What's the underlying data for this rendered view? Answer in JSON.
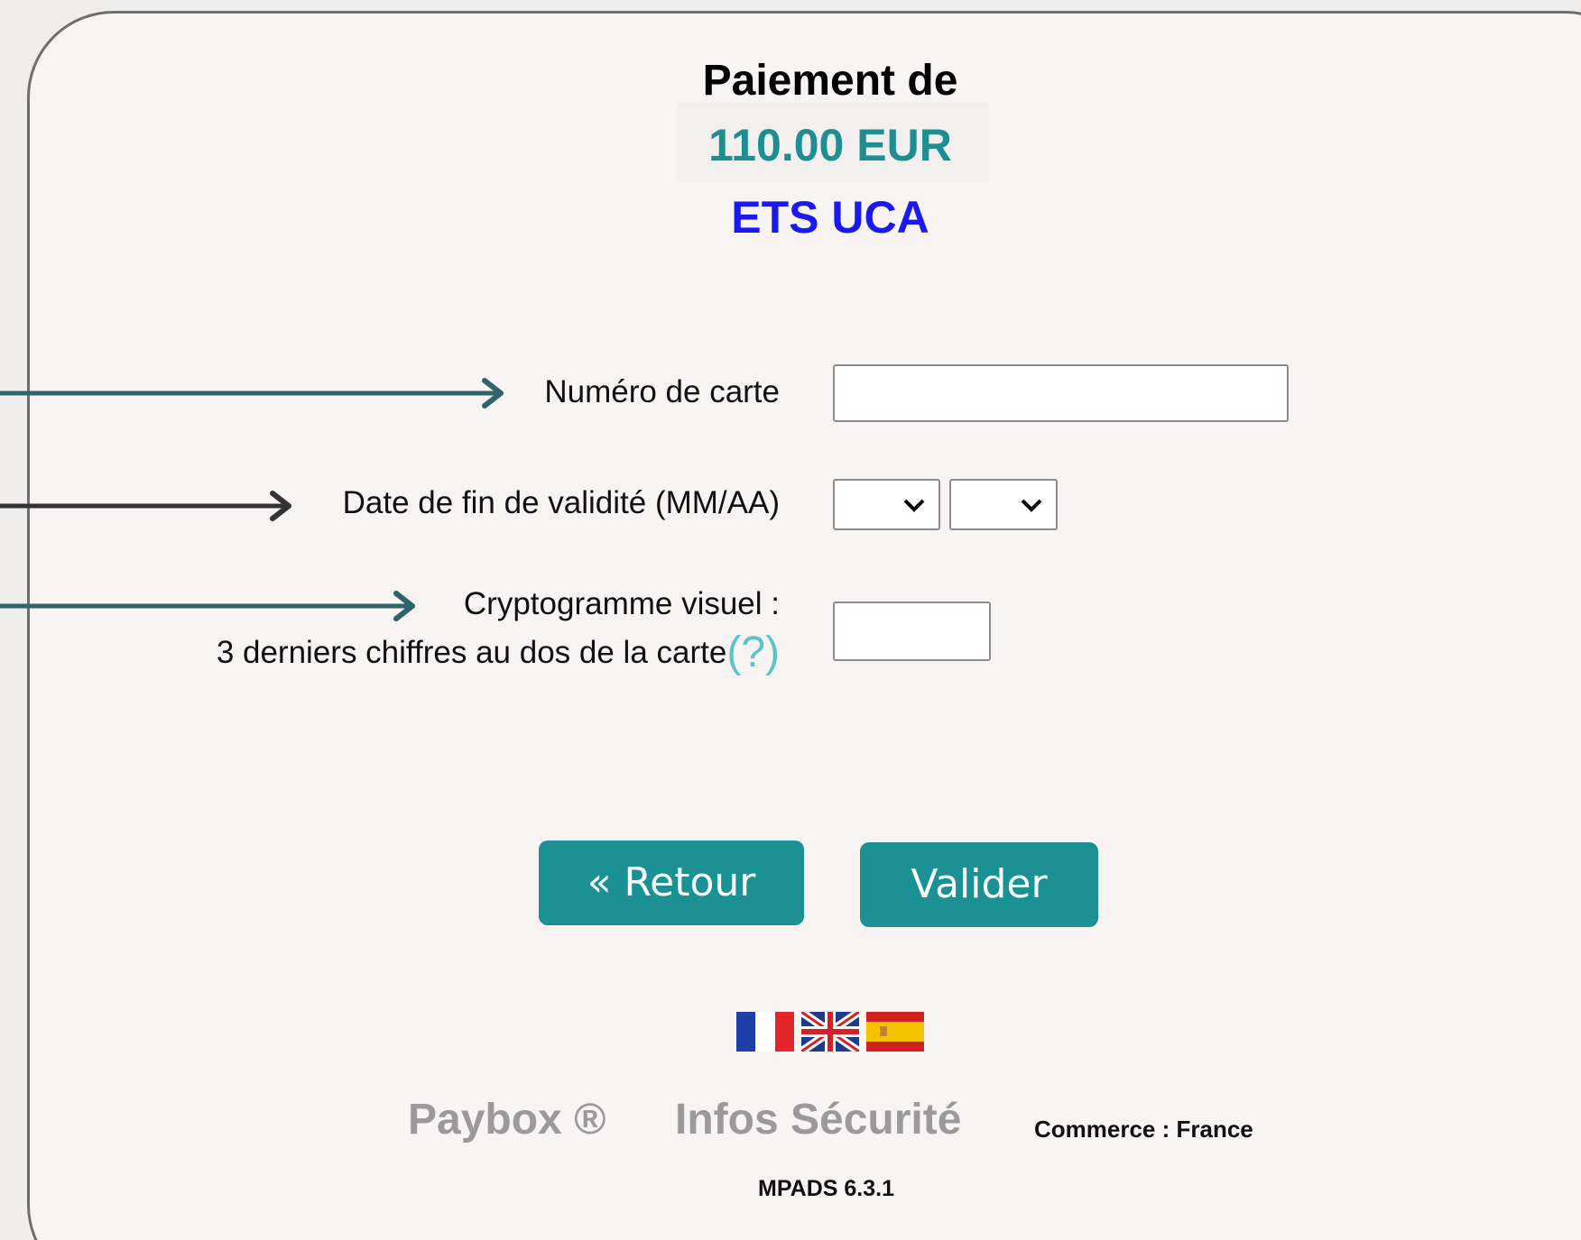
{
  "header": {
    "title": "Paiement de",
    "amount": "110.00 EUR",
    "merchant": "ETS UCA"
  },
  "form": {
    "card_number_label": "Numéro de carte",
    "card_number_value": "",
    "expiry_label": "Date de fin de validité (MM/AA)",
    "expiry_month_value": "",
    "expiry_year_value": "",
    "cvv_label_line1": "Cryptogramme visuel :",
    "cvv_label_line2": "3 derniers chiffres au dos de la carte",
    "cvv_help": "(?)",
    "cvv_value": ""
  },
  "buttons": {
    "back": "« Retour",
    "submit": "Valider"
  },
  "languages": [
    "fr-flag-icon",
    "uk-flag-icon",
    "es-flag-icon"
  ],
  "footer": {
    "paybox": "Paybox ®",
    "security": "Infos Sécurité",
    "commerce": "Commerce : France",
    "version": "MPADS 6.3.1"
  },
  "colors": {
    "accent": "#1b9194",
    "amount": "#1e8e90",
    "merchant": "#1a1af0",
    "arrow_teal": "#2f6469",
    "arrow_dark": "#333333"
  }
}
